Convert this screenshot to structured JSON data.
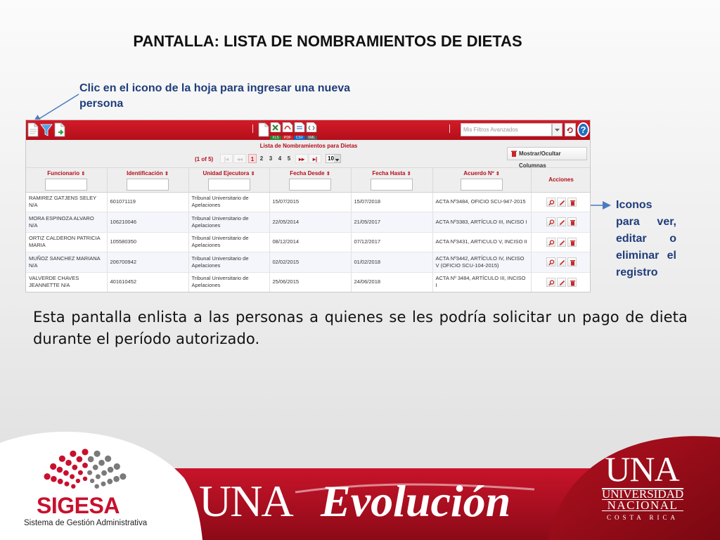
{
  "slide": {
    "title": "PANTALLA: LISTA DE NOMBRAMIENTOS DE DIETAS",
    "callout_new": "Clic en el icono de la hoja para ingresar una nueva persona",
    "callout_actions": "Iconos para ver, editar o eliminar el registro",
    "description": "Esta pantalla enlista a las personas a quienes se les podría solicitar un pago de dieta durante el período autorizado."
  },
  "toolbar": {
    "export_xls": "XLS",
    "export_pdf": "PDF",
    "export_csv": "CSV",
    "export_xml": "XML",
    "filters_placeholder": "Mis Filtros Avanzados",
    "help": "?"
  },
  "list": {
    "title": "Lista de Nombramientos para Dietas",
    "page_info": "(1 of 5)",
    "pages": [
      "1",
      "2",
      "3",
      "4",
      "5"
    ],
    "rows_per_page": "10",
    "toggle_columns": "Mostrar/Ocultar Columnas"
  },
  "table": {
    "columns": [
      "Funcionario",
      "Identificación",
      "Unidad Ejecutora",
      "Fecha Desde",
      "Fecha Hasta",
      "Acuerdo Nº",
      "Acciones"
    ],
    "rows": [
      {
        "funcionario": "RAMIREZ GATJENS SELEY N/A",
        "id": "601071119",
        "unidad": "Tribunal Universitario de Apelaciones",
        "desde": "15/07/2015",
        "hasta": "15/07/2018",
        "acuerdo": "ACTA Nº3484, OFICIO SCU-947-2015"
      },
      {
        "funcionario": "MORA ESPINOZA ALVARO N/A",
        "id": "106210046",
        "unidad": "Tribunal Universitario de Apelaciones",
        "desde": "22/05/2014",
        "hasta": "21/05/2017",
        "acuerdo": "ACTA Nº3383, ARTÍCULO III, INCISO I"
      },
      {
        "funcionario": "ORTIZ CALDERON PATRICIA MARIA",
        "id": "105580350",
        "unidad": "Tribunal Universitario de Apelaciones",
        "desde": "08/12/2014",
        "hasta": "07/12/2017",
        "acuerdo": "ACTA Nº3431, ARTICULO V, INCISO II"
      },
      {
        "funcionario": "MUÑOZ SANCHEZ MARIANA N/A",
        "id": "206700942",
        "unidad": "Tribunal Universitario de Apelaciones",
        "desde": "02/02/2015",
        "hasta": "01/02/2018",
        "acuerdo": "ACTA Nº3442, ARTÍCULO IV, INCISO V (OFICIO SCU-104-2015)"
      },
      {
        "funcionario": "VALVERDE CHAVES JEANNETTE N/A",
        "id": "401610452",
        "unidad": "Tribunal Universitario de Apelaciones",
        "desde": "25/06/2015",
        "hasta": "24/06/2018",
        "acuerdo": "ACTA Nº 3484, ARTÍCULO III, INCISO I"
      }
    ]
  },
  "footer": {
    "brand_una": "UNA",
    "brand_evolucion": "Evolución",
    "sigesa": "SIGESA",
    "sigesa_sub": "Sistema de Gestión Administrativa",
    "una_logo": "UNA",
    "una_universidad": "UNIVERSIDAD",
    "una_nacional": "NACIONAL",
    "una_costa_rica": "COSTA RICA"
  },
  "colors": {
    "brand_red": "#c8102e",
    "toolbar_red": "#d31b28",
    "callout_blue": "#1f3d7a"
  }
}
